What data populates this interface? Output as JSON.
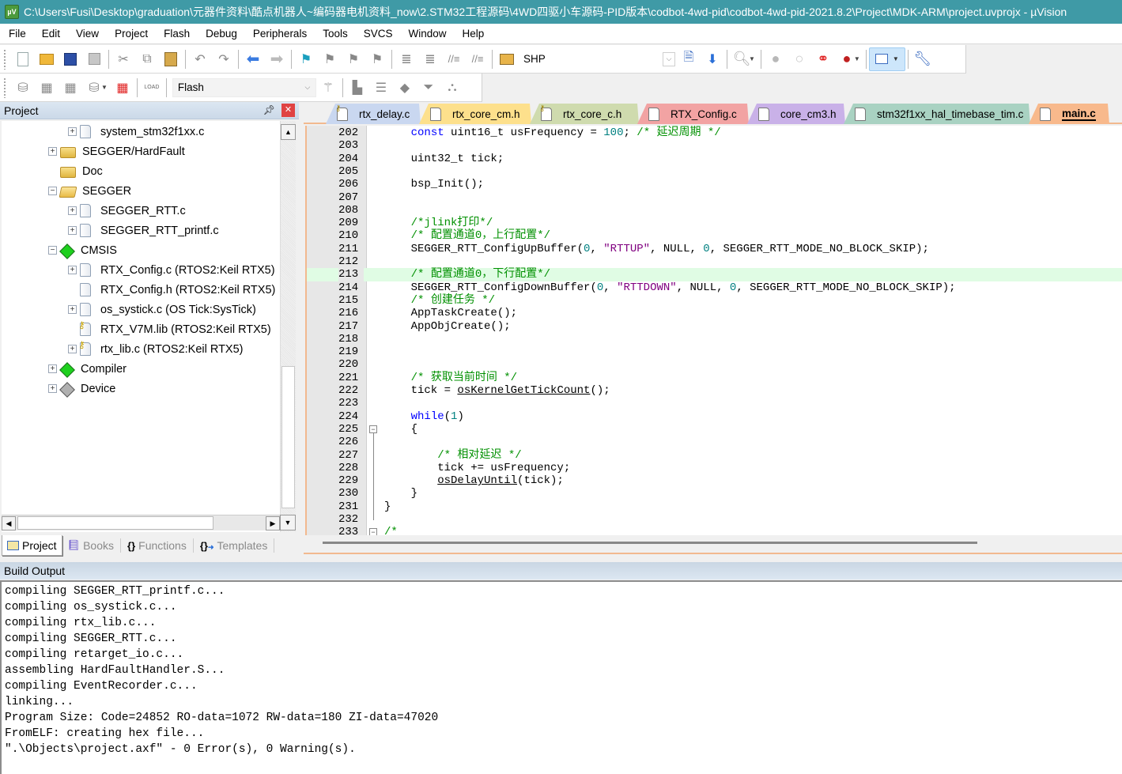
{
  "window": {
    "title": "C:\\Users\\Fusi\\Desktop\\graduation\\元器件资料\\酷点机器人~编码器电机资料_now\\2.STM32工程源码\\4WD四驱小车源码-PID版本\\codbot-4wd-pid\\codbot-4wd-pid-2021.8.2\\Project\\MDK-ARM\\project.uvprojx - µVision",
    "app_icon": "keil-uvision-icon"
  },
  "menu": [
    "File",
    "Edit",
    "View",
    "Project",
    "Flash",
    "Debug",
    "Peripherals",
    "Tools",
    "SVCS",
    "Window",
    "Help"
  ],
  "toolbar1": {
    "find_combo_value": "SHP"
  },
  "toolbar2": {
    "target_combo_value": "Flash",
    "load_label": "LOAD"
  },
  "project_panel": {
    "title": "Project",
    "tree": [
      {
        "label": "system_stm32f1xx.c",
        "type": "file",
        "level": 2,
        "expander": "+"
      },
      {
        "label": "SEGGER/HardFault",
        "type": "folder",
        "level": 1,
        "expander": "+"
      },
      {
        "label": "Doc",
        "type": "folder",
        "level": 1,
        "expander": ""
      },
      {
        "label": "SEGGER",
        "type": "folder-open",
        "level": 1,
        "expander": "-"
      },
      {
        "label": "SEGGER_RTT.c",
        "type": "file",
        "level": 2,
        "expander": "+"
      },
      {
        "label": "SEGGER_RTT_printf.c",
        "type": "file",
        "level": 2,
        "expander": "+"
      },
      {
        "label": "CMSIS",
        "type": "component",
        "level": 1,
        "expander": "-"
      },
      {
        "label": "RTX_Config.c (RTOS2:Keil RTX5)",
        "type": "file",
        "level": 2,
        "expander": "+"
      },
      {
        "label": "RTX_Config.h (RTOS2:Keil RTX5)",
        "type": "file",
        "level": 2,
        "expander": ""
      },
      {
        "label": "os_systick.c (OS Tick:SysTick)",
        "type": "file",
        "level": 2,
        "expander": "+"
      },
      {
        "label": "RTX_V7M.lib (RTOS2:Keil RTX5)",
        "type": "file-key",
        "level": 2,
        "expander": ""
      },
      {
        "label": "rtx_lib.c (RTOS2:Keil RTX5)",
        "type": "file-key",
        "level": 2,
        "expander": "+"
      },
      {
        "label": "Compiler",
        "type": "component",
        "level": 1,
        "expander": "+"
      },
      {
        "label": "Device",
        "type": "component-grey",
        "level": 1,
        "expander": "+"
      }
    ],
    "tabs": [
      {
        "label": "Project",
        "active": true
      },
      {
        "label": "Books",
        "active": false
      },
      {
        "label": "Functions",
        "active": false
      },
      {
        "label": "Templates",
        "active": false
      }
    ]
  },
  "editor": {
    "tabs": [
      {
        "label": "rtx_delay.c",
        "color": "#c9d7f0",
        "key": true,
        "active": false
      },
      {
        "label": "rtx_core_cm.h",
        "color": "#fde08c",
        "key": false,
        "active": false
      },
      {
        "label": "rtx_core_c.h",
        "color": "#cfdbae",
        "key": true,
        "active": false
      },
      {
        "label": "RTX_Config.c",
        "color": "#f2a3a3",
        "key": false,
        "active": false
      },
      {
        "label": "core_cm3.h",
        "color": "#c9b1e8",
        "key": false,
        "active": false
      },
      {
        "label": "stm32f1xx_hal_timebase_tim.c",
        "color": "#a9d2c2",
        "key": false,
        "active": false
      },
      {
        "label": "main.c",
        "color": "#f8b98c",
        "key": false,
        "active": true
      }
    ],
    "highlighted_line": 213,
    "lines": [
      {
        "n": "202",
        "tokens": [
          [
            "    ",
            ""
          ],
          [
            "const",
            "kw"
          ],
          [
            " uint16_t usFrequency = ",
            ""
          ],
          [
            "100",
            "num"
          ],
          [
            "; ",
            ""
          ],
          [
            "/* 延迟周期 */",
            "cm"
          ]
        ]
      },
      {
        "n": "203",
        "tokens": []
      },
      {
        "n": "204",
        "tokens": [
          [
            "    uint32_t tick;",
            ""
          ]
        ]
      },
      {
        "n": "205",
        "tokens": []
      },
      {
        "n": "206",
        "tokens": [
          [
            "    bsp_Init();",
            ""
          ]
        ]
      },
      {
        "n": "207",
        "tokens": []
      },
      {
        "n": "208",
        "tokens": []
      },
      {
        "n": "209",
        "tokens": [
          [
            "    ",
            ""
          ],
          [
            "/*jlink打印*/",
            "cm"
          ]
        ]
      },
      {
        "n": "210",
        "tokens": [
          [
            "    ",
            ""
          ],
          [
            "/* 配置通道0，上行配置*/",
            "cm"
          ]
        ]
      },
      {
        "n": "211",
        "tokens": [
          [
            "    SEGGER_RTT_ConfigUpBuffer(",
            ""
          ],
          [
            "0",
            "num"
          ],
          [
            ", ",
            ""
          ],
          [
            "\"RTTUP\"",
            "str"
          ],
          [
            ", NULL, ",
            ""
          ],
          [
            "0",
            "num"
          ],
          [
            ", SEGGER_RTT_MODE_NO_BLOCK_SKIP);",
            ""
          ]
        ]
      },
      {
        "n": "212",
        "tokens": []
      },
      {
        "n": "213",
        "tokens": [
          [
            "    ",
            ""
          ],
          [
            "/* 配置通道0，下行配置*/",
            "cm"
          ]
        ]
      },
      {
        "n": "214",
        "tokens": [
          [
            "    SEGGER_RTT_ConfigDownBuffer(",
            ""
          ],
          [
            "0",
            "num"
          ],
          [
            ", ",
            ""
          ],
          [
            "\"RTTDOWN\"",
            "str"
          ],
          [
            ", NULL, ",
            ""
          ],
          [
            "0",
            "num"
          ],
          [
            ", SEGGER_RTT_MODE_NO_BLOCK_SKIP);",
            ""
          ]
        ]
      },
      {
        "n": "215",
        "tokens": [
          [
            "    ",
            ""
          ],
          [
            "/* 创建任务 */",
            "cm"
          ]
        ]
      },
      {
        "n": "216",
        "tokens": [
          [
            "    AppTaskCreate();",
            ""
          ]
        ]
      },
      {
        "n": "217",
        "tokens": [
          [
            "    AppObjCreate();",
            ""
          ]
        ]
      },
      {
        "n": "218",
        "tokens": []
      },
      {
        "n": "219",
        "tokens": []
      },
      {
        "n": "220",
        "tokens": []
      },
      {
        "n": "221",
        "tokens": [
          [
            "    ",
            ""
          ],
          [
            "/* 获取当前时间 */",
            "cm"
          ]
        ]
      },
      {
        "n": "222",
        "tokens": [
          [
            "    tick = ",
            ""
          ],
          [
            "osKernelGetTickCount",
            "ul"
          ],
          [
            "();",
            ""
          ]
        ]
      },
      {
        "n": "223",
        "tokens": []
      },
      {
        "n": "224",
        "tokens": [
          [
            "    ",
            ""
          ],
          [
            "while",
            "kw"
          ],
          [
            "(",
            ""
          ],
          [
            "1",
            "num"
          ],
          [
            ")",
            ""
          ]
        ]
      },
      {
        "n": "225",
        "tokens": [
          [
            "    {",
            ""
          ]
        ]
      },
      {
        "n": "226",
        "tokens": []
      },
      {
        "n": "227",
        "tokens": [
          [
            "        ",
            ""
          ],
          [
            "/* 相对延迟 */",
            "cm"
          ]
        ]
      },
      {
        "n": "228",
        "tokens": [
          [
            "        tick += usFrequency;",
            ""
          ]
        ]
      },
      {
        "n": "229",
        "tokens": [
          [
            "        ",
            ""
          ],
          [
            "osDelayUntil",
            "ul"
          ],
          [
            "(tick);",
            ""
          ]
        ]
      },
      {
        "n": "230",
        "tokens": [
          [
            "    }",
            ""
          ]
        ]
      },
      {
        "n": "231",
        "tokens": [
          [
            "}",
            ""
          ]
        ]
      },
      {
        "n": "232",
        "tokens": []
      },
      {
        "n": "233",
        "tokens": [
          [
            "/*",
            "cm"
          ]
        ]
      }
    ]
  },
  "build_output": {
    "title": "Build Output",
    "lines": [
      "compiling SEGGER_RTT_printf.c...",
      "compiling os_systick.c...",
      "compiling rtx_lib.c...",
      "compiling SEGGER_RTT.c...",
      "compiling retarget_io.c...",
      "assembling HardFaultHandler.S...",
      "compiling EventRecorder.c...",
      "linking...",
      "Program Size: Code=24852 RO-data=1072 RW-data=180 ZI-data=47020",
      "FromELF: creating hex file...",
      "\".\\Objects\\project.axf\" - 0 Error(s), 0 Warning(s)."
    ]
  }
}
